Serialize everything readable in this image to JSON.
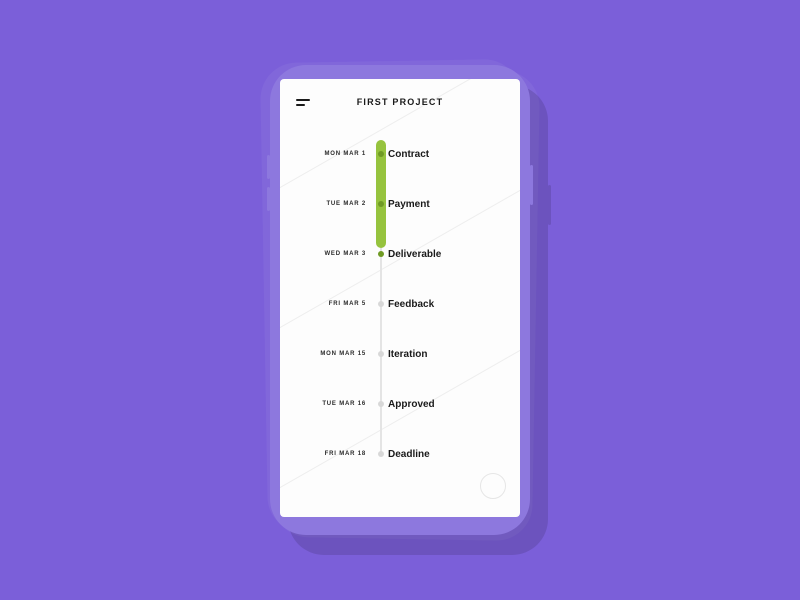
{
  "header": {
    "title": "FIRST PROJECT"
  },
  "timeline": [
    {
      "date": "MON MAR 1",
      "label": "Contract",
      "status": "done"
    },
    {
      "date": "TUE MAR 2",
      "label": "Payment",
      "status": "done"
    },
    {
      "date": "WED MAR 3",
      "label": "Deliverable",
      "status": "done"
    },
    {
      "date": "FRI MAR 5",
      "label": "Feedback",
      "status": "pending"
    },
    {
      "date": "MON MAR 15",
      "label": "Iteration",
      "status": "pending"
    },
    {
      "date": "TUE MAR 16",
      "label": "Approved",
      "status": "pending"
    },
    {
      "date": "FRI MAR 18",
      "label": "Deadline",
      "status": "pending"
    }
  ],
  "colors": {
    "background": "#7b5fd9",
    "accent": "#96c33e"
  }
}
